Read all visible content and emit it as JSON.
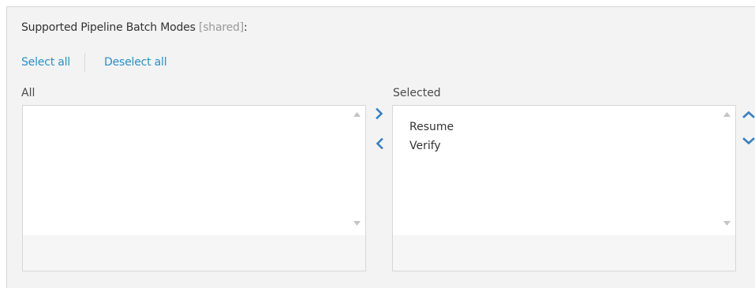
{
  "header": {
    "title": "Supported Pipeline Batch Modes",
    "shared_tag": "[shared]",
    "title_suffix": ":"
  },
  "actions": {
    "select_all": "Select all",
    "deselect_all": "Deselect all"
  },
  "all_list": {
    "label": "All",
    "items": []
  },
  "selected_list": {
    "label": "Selected",
    "items": [
      "Resume",
      "Verify"
    ]
  },
  "icons": {
    "move_right": "chevron-right-icon",
    "move_left": "chevron-left-icon",
    "move_up": "chevron-up-icon",
    "move_down": "chevron-down-icon"
  },
  "colors": {
    "accent": "#2b8fc7",
    "arrow": "#3a7ebf",
    "panel_bg": "#f3f3f3"
  }
}
